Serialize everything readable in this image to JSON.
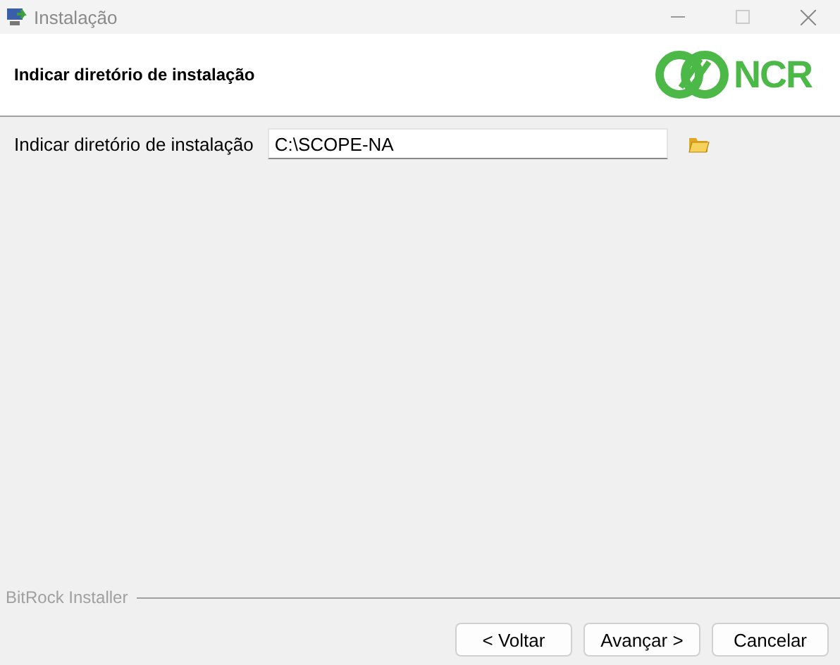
{
  "window": {
    "title": "Instalação"
  },
  "header": {
    "title": "Indicar diretório de instalação",
    "logo_text": "NCR"
  },
  "field": {
    "label": "Indicar diretório de instalação",
    "value": "C:\\SCOPE-NA"
  },
  "footer": {
    "brand": "BitRock Installer"
  },
  "buttons": [
    "< Voltar",
    "Avançar >",
    "Cancelar"
  ]
}
